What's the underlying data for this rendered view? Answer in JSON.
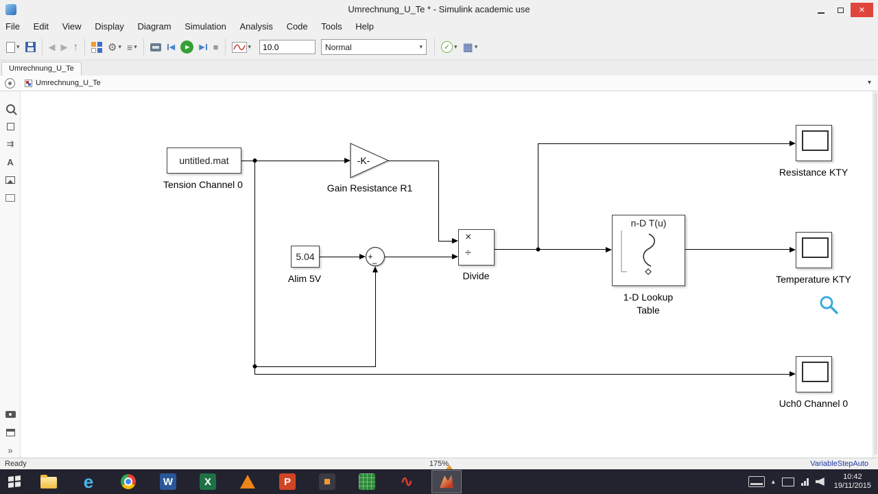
{
  "window": {
    "title": "Umrechnung_U_Te * - Simulink academic use"
  },
  "menu": {
    "items": [
      "File",
      "Edit",
      "View",
      "Display",
      "Diagram",
      "Simulation",
      "Analysis",
      "Code",
      "Tools",
      "Help"
    ]
  },
  "toolbar": {
    "stop_time": "10.0",
    "mode": "Normal"
  },
  "tabs": {
    "active": "Umrechnung_U_Te"
  },
  "breadcrumb": {
    "path": "Umrechnung_U_Te"
  },
  "palette": {
    "signal": "⇉",
    "annotation": "A",
    "expand": "»"
  },
  "canvas": {
    "from_file": {
      "text": "untitled.mat",
      "label": "Tension Channel 0"
    },
    "gain": {
      "text": "-K-",
      "label": "Gain Resistance R1"
    },
    "constant": {
      "text": "5.04",
      "label": "Alim 5V"
    },
    "sum": {
      "sign_plus": "+",
      "sign_minus": "–"
    },
    "divide": {
      "sign_times": "×",
      "sign_divide": "÷",
      "label": "Divide"
    },
    "lookup": {
      "header": "n-D T(u)",
      "label": "1-D Lookup Table"
    },
    "scopes": [
      {
        "label": "Resistance KTY"
      },
      {
        "label": "Temperature KTY"
      },
      {
        "label": "Uch0 Channel 0"
      }
    ]
  },
  "statusbar": {
    "left": "Ready",
    "zoom": "175%",
    "solver": "VariableStepAuto"
  },
  "taskbar": {
    "time": "10:42",
    "date": "19/11/2015"
  },
  "icons": {
    "dropdown": "▾",
    "close": "×",
    "back": "◀",
    "forward": "▶",
    "up": "↑",
    "gear": "⚙",
    "list": "≡",
    "step_back": "◀",
    "run": "▶",
    "step_forward": "▶",
    "stop": "■",
    "check": "✓",
    "build": "▦",
    "ie": "e",
    "word": "W",
    "excel": "X",
    "ppt": "P",
    "wave": "∿",
    "tray_chevron": "▴"
  }
}
